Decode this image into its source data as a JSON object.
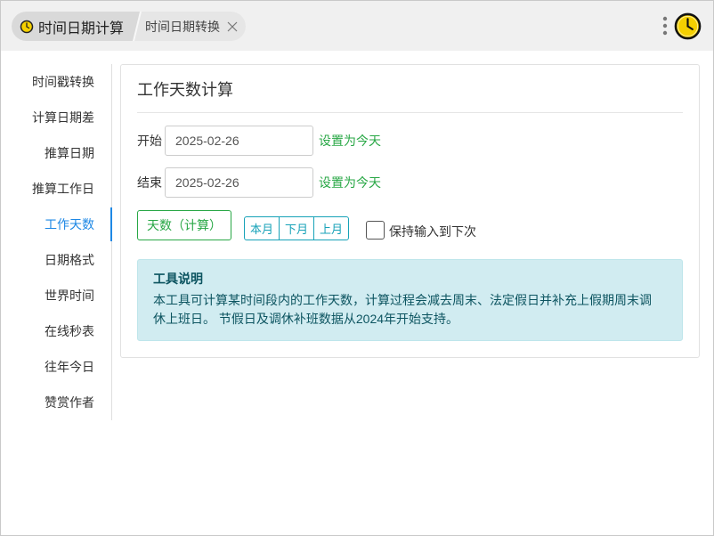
{
  "header": {
    "breadcrumb": {
      "current": {
        "label": "时间日期计算",
        "icon": "clock-icon"
      },
      "tab": {
        "label": "时间日期转换",
        "close_icon": "close-icon"
      }
    },
    "actions": {
      "menu_icon": "more-vertical-icon",
      "app_icon": "clock-icon"
    }
  },
  "sidebar": {
    "items": [
      {
        "label": "时间戳转换",
        "active": false
      },
      {
        "label": "计算日期差",
        "active": false
      },
      {
        "label": "推算日期",
        "active": false
      },
      {
        "label": "推算工作日",
        "active": false
      },
      {
        "label": "工作天数",
        "active": true
      },
      {
        "label": "日期格式",
        "active": false
      },
      {
        "label": "世界时间",
        "active": false
      },
      {
        "label": "在线秒表",
        "active": false
      },
      {
        "label": "往年今日",
        "active": false
      },
      {
        "label": "赞赏作者",
        "active": false
      }
    ]
  },
  "card": {
    "title": "工作天数计算",
    "start": {
      "label": "开始",
      "value": "2025-02-26",
      "today_link": "设置为今天"
    },
    "end": {
      "label": "结束",
      "value": "2025-02-26",
      "today_link": "设置为今天"
    },
    "calculate_button": "天数（计算）",
    "quick_ranges": [
      "本月",
      "下月",
      "上月"
    ],
    "keep_input": {
      "label": "保持输入到下次",
      "checked": false
    },
    "info": {
      "title": "工具说明",
      "text": "本工具可计算某时间段内的工作天数，计算过程会减去周末、法定假日并补充上假期周末调休上班日。 节假日及调休补班数据从2024年开始支持。"
    }
  },
  "colors": {
    "accent_blue": "#1e88e5",
    "success_green": "#28a745",
    "info_teal": "#17a2b8",
    "info_bg": "#d1ecf1",
    "info_text": "#0c5460",
    "clock_yellow": "#f5d000"
  }
}
